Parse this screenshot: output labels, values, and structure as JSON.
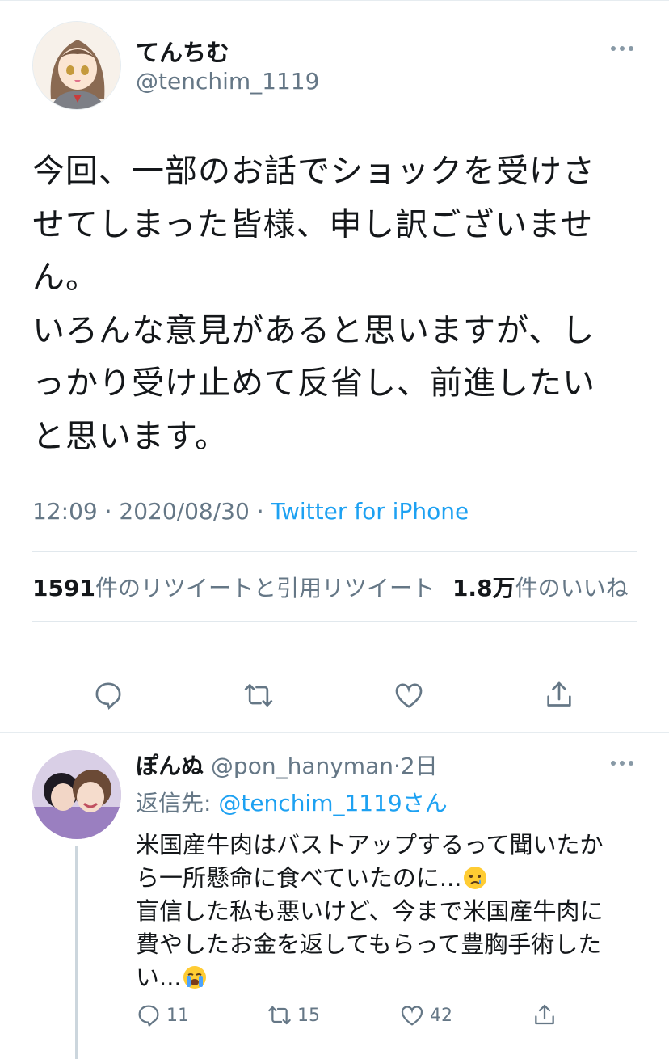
{
  "tweet": {
    "display_name": "てんちむ",
    "handle": "@tenchim_1119",
    "text": "今回、一部のお話でショックを受けさ\nせてしまった皆様、申し訳ございませ\nん。\nいろんな意見があると思いますが、し\nっかり受け止めて反省し、前進したい\nと思います。",
    "time": "12:09",
    "date": "2020/08/30",
    "separator": "·",
    "source": "Twitter for iPhone",
    "retweet_count": "1591",
    "retweet_label": "件のリツイートと引用リツイート",
    "like_count": "1.8万",
    "like_label": "件のいいね"
  },
  "reply": {
    "display_name": "ぽんぬ",
    "handle": "@pon_hanyman",
    "separator": "·",
    "age": "2日",
    "replying_label": "返信先: ",
    "replying_to": "@tenchim_1119さん",
    "text_1": "米国産牛肉はバストアップするって聞いたか\nら一所懸命に食べていたのに...",
    "text_2": "\n盲信した私も悪いけど、今まで米国産牛肉に\n費やしたお金を返してもらって豊胸手術した\nい...",
    "reply_count": "11",
    "retweet_count": "15",
    "like_count": "42"
  },
  "icons": {
    "more": "more-horizontal-icon",
    "reply": "speech-bubble-icon",
    "retweet": "retweet-arrows-icon",
    "like": "heart-icon",
    "share": "share-upload-icon",
    "emoji_1": "crying-face-emoji",
    "emoji_2": "loudly-crying-face-emoji"
  },
  "colors": {
    "link_blue": "#1da1f2",
    "secondary_gray": "#657786",
    "divider": "#e1e8ed"
  }
}
